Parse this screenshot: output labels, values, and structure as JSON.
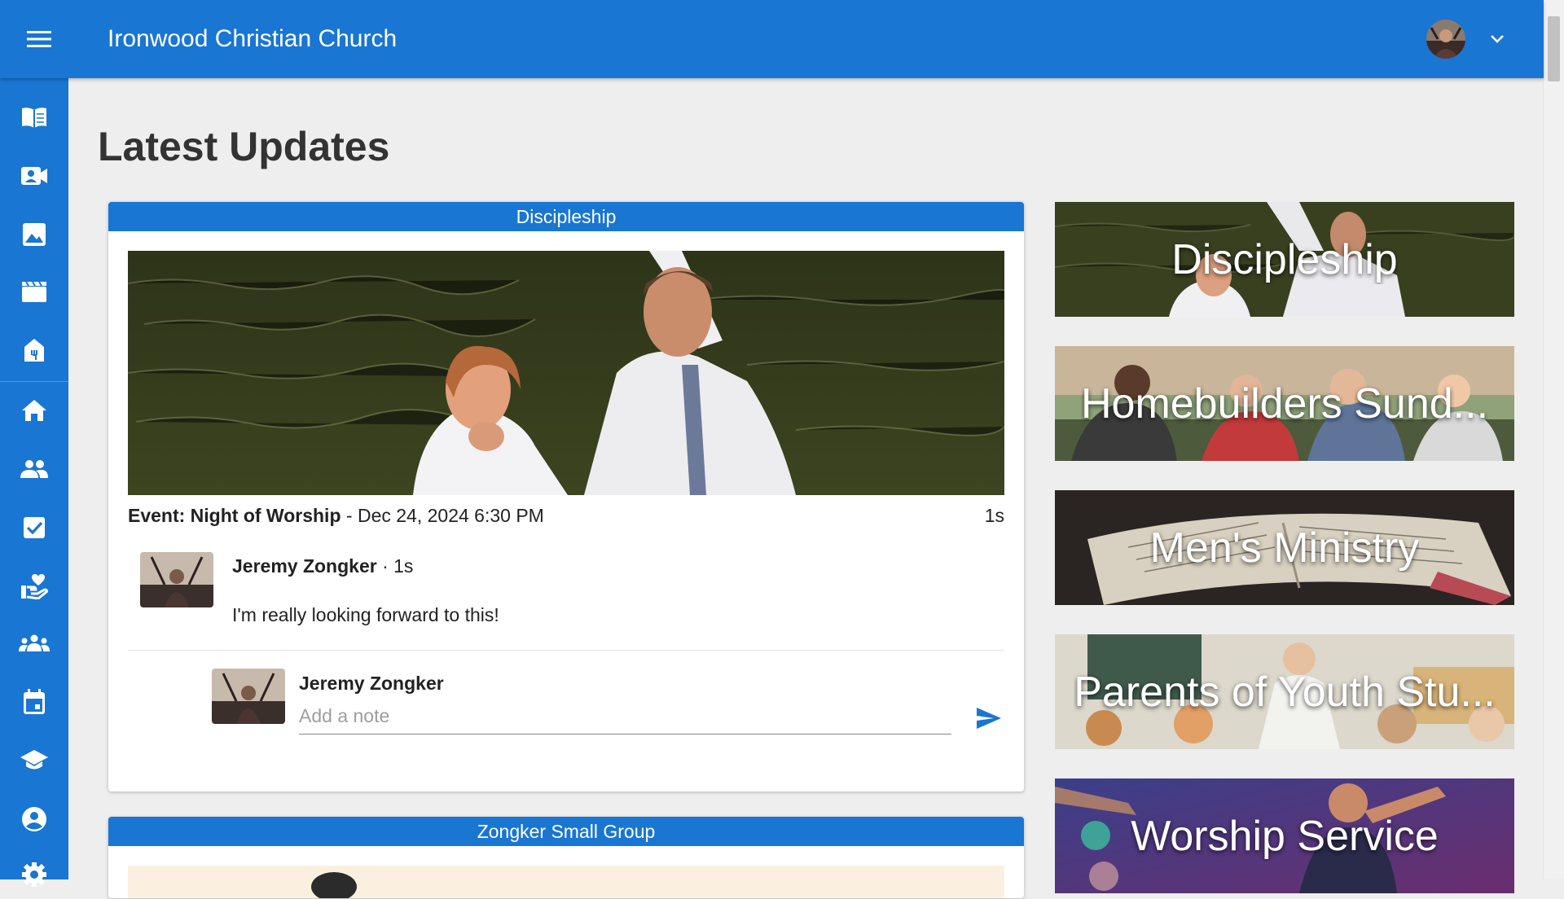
{
  "app": {
    "title": "Ironwood Christian Church"
  },
  "header": {
    "avatar_icon": "user-avatar",
    "menu_icon": "menu-icon",
    "caret_icon": "chevron-down-icon"
  },
  "sidebar": {
    "items": [
      {
        "icon": "bible-icon"
      },
      {
        "icon": "video-icon"
      },
      {
        "icon": "image-icon"
      },
      {
        "icon": "clapperboard-icon"
      },
      {
        "icon": "church-icon"
      },
      {
        "icon": "home-icon"
      },
      {
        "icon": "people-icon"
      },
      {
        "icon": "checkbox-icon"
      },
      {
        "icon": "volunteer-icon"
      },
      {
        "icon": "groups-icon"
      },
      {
        "icon": "calendar-icon"
      },
      {
        "icon": "school-icon"
      },
      {
        "icon": "account-icon"
      },
      {
        "icon": "settings-icon"
      }
    ]
  },
  "main": {
    "page_title": "Latest Updates",
    "feed": [
      {
        "group": "Discipleship",
        "event_label": "Event: Night of Worship",
        "event_date": " - Dec 24, 2024 6:30 PM",
        "event_age": "1s",
        "comment": {
          "author": "Jeremy Zongker",
          "age": " · 1s",
          "text": "I'm really looking forward to this!"
        },
        "note": {
          "author": "Jeremy Zongker",
          "placeholder": "Add a note",
          "value": ""
        }
      },
      {
        "group": "Zongker Small Group"
      }
    ]
  },
  "groups": [
    {
      "name": "Discipleship"
    },
    {
      "name": "Homebuilders Sund..."
    },
    {
      "name": "Men's Ministry"
    },
    {
      "name": "Parents of Youth Stu..."
    },
    {
      "name": "Worship Service"
    }
  ],
  "colors": {
    "primary": "#1976d2",
    "background": "#eeeeee"
  }
}
